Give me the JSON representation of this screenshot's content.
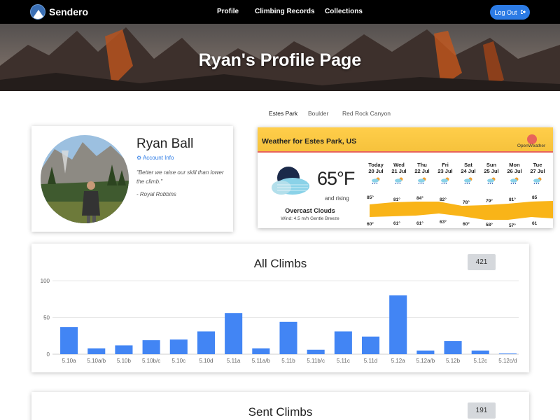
{
  "nav": {
    "brand": "Sendero",
    "links": [
      "Profile",
      "Climbing Records",
      "Collections"
    ],
    "logout_label": "Log Out",
    "logout_icon": "sign-out-icon",
    "accent": "#2c7be5"
  },
  "hero": {
    "title": "Ryan's Profile Page"
  },
  "locations": {
    "tabs": [
      "Estes Park",
      "Boulder",
      "Red Rock Canyon"
    ],
    "active": "Estes Park"
  },
  "profile": {
    "name": "Ryan Ball",
    "account_link": "Account Info",
    "account_icon": "gear-icon",
    "quote": "\"Better we raise our skill than lower the climb.\"",
    "quote_author": "- Royal Robbins"
  },
  "weather": {
    "title": "Weather for Estes Park, US",
    "provider": "OpenWeather",
    "temp": "65°F",
    "trend": "and rising",
    "condition": "Overcast Clouds",
    "wind": "Wind: 4.5 m/h Gentle Breeze",
    "forecast": [
      {
        "day": "Today",
        "date": "20 Jul",
        "hi": "85°",
        "lo": "60°"
      },
      {
        "day": "Wed",
        "date": "21 Jul",
        "hi": "81°",
        "lo": "61°"
      },
      {
        "day": "Thu",
        "date": "22 Jul",
        "hi": "84°",
        "lo": "61°"
      },
      {
        "day": "Fri",
        "date": "23 Jul",
        "hi": "82°",
        "lo": "63°"
      },
      {
        "day": "Sat",
        "date": "24 Jul",
        "hi": "78°",
        "lo": "60°"
      },
      {
        "day": "Sun",
        "date": "25 Jul",
        "hi": "79°",
        "lo": "58°"
      },
      {
        "day": "Mon",
        "date": "26 Jul",
        "hi": "81°",
        "lo": "57°"
      },
      {
        "day": "Tue",
        "date": "27 Jul",
        "hi": "85",
        "lo": "61"
      }
    ],
    "header_color": "#f6c23c",
    "band_color": "#f9b418"
  },
  "all_climbs": {
    "title": "All Climbs",
    "count": "421"
  },
  "sent_climbs": {
    "title": "Sent Climbs",
    "count": "191"
  },
  "chart_data": {
    "type": "bar",
    "title": "All Climbs",
    "categories": [
      "5.10a",
      "5.10a/b",
      "5.10b",
      "5.10b/c",
      "5.10c",
      "5.10d",
      "5.11a",
      "5.11a/b",
      "5.11b",
      "5.11b/c",
      "5.11c",
      "5.11d",
      "5.12a",
      "5.12a/b",
      "5.12b",
      "5.12c",
      "5.12c/d"
    ],
    "values": [
      37,
      8,
      12,
      19,
      20,
      31,
      56,
      8,
      44,
      6,
      31,
      24,
      80,
      5,
      18,
      5,
      1
    ],
    "ylim": [
      0,
      100
    ],
    "yticks": [
      0,
      50,
      100
    ],
    "grid": true,
    "color": "#4285f4"
  }
}
